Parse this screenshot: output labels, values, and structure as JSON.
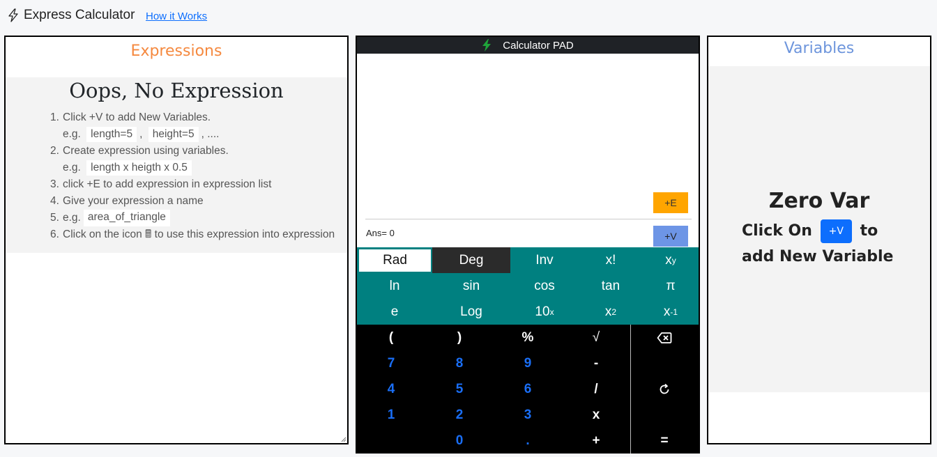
{
  "header": {
    "app_title": "Express Calculator",
    "how_link": "How it Works"
  },
  "expressions": {
    "title": "Expressions",
    "empty_title": "Oops, No Expression",
    "steps": [
      {
        "num": "1.",
        "text": "Click +V to add New Variables."
      },
      {
        "num": "2.",
        "text": "Create expression using variables."
      },
      {
        "num": "3.",
        "text": "click +E to add expression in expression list"
      },
      {
        "num": "4.",
        "text": "Give your expression a name"
      },
      {
        "num": "5.",
        "text": "e.g."
      },
      {
        "num": "6.",
        "text": "Click on the icon 🖩 to use this expression into expression"
      }
    ],
    "eg_label": "e.g.",
    "example1_a": "length=5",
    "example1_sep": ",",
    "example1_b": "height=5",
    "example1_more": ", ....",
    "example2": "length x heigth x 0.5",
    "example_name": "area_of_triangle"
  },
  "calculator": {
    "title": "Calculator PAD",
    "add_expr_button": "+E",
    "add_var_button": "+V",
    "ans": "Ans= 0",
    "sci": {
      "rad": "Rad",
      "deg": "Deg",
      "inv": "Inv",
      "fact": "x!",
      "pow": "x",
      "pow_sup": "y",
      "ln": "ln",
      "sin": "sin",
      "cos": "cos",
      "tan": "tan",
      "pi": "π",
      "e": "e",
      "log": "Log",
      "tenx": "10",
      "tenx_sup": "x",
      "sq": "x",
      "sq_sup": "2",
      "inv_x": "x",
      "inv_x_sup": "-1"
    },
    "keys": {
      "lparen": "(",
      "rparen": ")",
      "percent": "%",
      "sqrt": "√",
      "k7": "7",
      "k8": "8",
      "k9": "9",
      "minus": "-",
      "k4": "4",
      "k5": "5",
      "k6": "6",
      "divide": "/",
      "k1": "1",
      "k2": "2",
      "k3": "3",
      "times": "x",
      "k0": "0",
      "dot": ".",
      "plus": "+",
      "equals": "="
    }
  },
  "variables": {
    "title": "Variables",
    "empty_title": "Zero Var",
    "click_on": "Click On",
    "badge": "+V",
    "to": "to",
    "add_new": "add New Variable"
  },
  "colors": {
    "expressions_title": "#f5893f",
    "variables_title": "#6d95dc",
    "sci_bg": "#008080",
    "add_expr": "#ffa500",
    "add_var": "#6d95e6",
    "digit": "#1a6ef5"
  }
}
